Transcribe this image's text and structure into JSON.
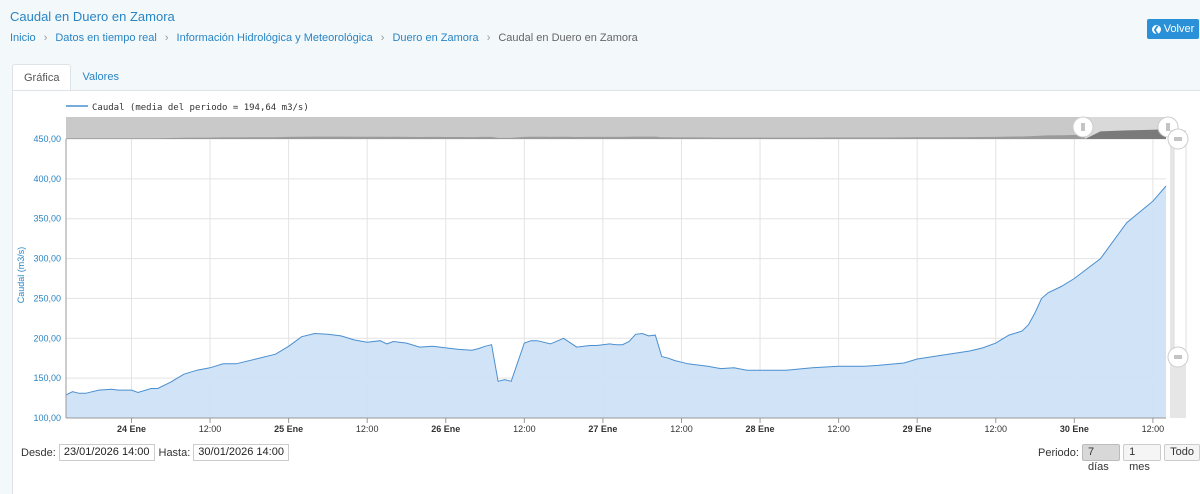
{
  "page": {
    "title": "Caudal en Duero en Zamora",
    "back_label": "Volver",
    "breadcrumb": [
      "Inicio",
      "Datos en tiempo real",
      "Información Hidrológica y Meteorológica",
      "Duero en Zamora",
      "Caudal en Duero en Zamora"
    ]
  },
  "tabs": [
    {
      "label": "Gráfica",
      "active": true
    },
    {
      "label": "Valores",
      "active": false
    }
  ],
  "range": {
    "from_label": "Desde:",
    "from_value": "23/01/2026 14:00",
    "to_label": "Hasta:",
    "to_value": "30/01/2026 14:00",
    "period_label": "Periodo:",
    "period_options": [
      "7 días",
      "1 mes",
      "Todo"
    ],
    "period_selected": "7 días"
  },
  "chart_data": {
    "type": "area",
    "legend": "Caudal (media del periodo = 194,64 m3/s)",
    "legend_placement": "top-left",
    "ylabel": "Caudal (m3/s)",
    "ylim": [
      100,
      450
    ],
    "yticks": [
      "100,00",
      "150,00",
      "200,00",
      "250,00",
      "300,00",
      "350,00",
      "400,00",
      "450,00"
    ],
    "ytick_values": [
      100,
      150,
      200,
      250,
      300,
      350,
      400,
      450
    ],
    "xlim": [
      "23/01/2026 14:00",
      "30/01/2026 14:00"
    ],
    "xticks": [
      "24 Ene",
      "12:00",
      "25 Ene",
      "12:00",
      "26 Ene",
      "12:00",
      "27 Ene",
      "12:00",
      "28 Ene",
      "12:00",
      "29 Ene",
      "12:00",
      "30 Ene",
      "12:00"
    ],
    "xtick_values": [
      "24/01/2026 00:00",
      "24/01/2026 12:00",
      "25/01/2026 00:00",
      "25/01/2026 12:00",
      "26/01/2026 00:00",
      "26/01/2026 12:00",
      "27/01/2026 00:00",
      "27/01/2026 12:00",
      "28/01/2026 00:00",
      "28/01/2026 12:00",
      "29/01/2026 00:00",
      "29/01/2026 12:00",
      "30/01/2026 00:00",
      "30/01/2026 12:00"
    ],
    "xtick_bold": [
      true,
      false,
      true,
      false,
      true,
      false,
      true,
      false,
      true,
      false,
      true,
      false,
      true,
      false
    ],
    "grid": true,
    "colors": {
      "line": "#4a8fd0",
      "fill": "#cfe2f5",
      "grid": "#e3e3e3",
      "axis_text": "#2a85c4",
      "navigator": "#c4c4c4"
    },
    "series": [
      {
        "x": [
          "23/01/2026 14:00",
          "23/01/2026 15:00",
          "23/01/2026 16:00",
          "23/01/2026 17:00",
          "23/01/2026 19:00",
          "23/01/2026 21:00",
          "23/01/2026 22:00",
          "24/01/2026 00:00",
          "24/01/2026 01:00",
          "24/01/2026 03:00",
          "24/01/2026 04:00",
          "24/01/2026 06:00",
          "24/01/2026 08:00",
          "24/01/2026 10:00",
          "24/01/2026 12:00",
          "24/01/2026 14:00",
          "24/01/2026 16:00",
          "24/01/2026 19:00",
          "24/01/2026 22:00",
          "25/01/2026 00:00",
          "25/01/2026 02:00",
          "25/01/2026 04:00",
          "25/01/2026 06:00",
          "25/01/2026 08:00",
          "25/01/2026 10:00",
          "25/01/2026 12:00",
          "25/01/2026 14:00",
          "25/01/2026 15:00",
          "25/01/2026 16:00",
          "25/01/2026 18:00",
          "25/01/2026 20:00",
          "25/01/2026 22:00",
          "26/01/2026 00:00",
          "26/01/2026 02:00",
          "26/01/2026 04:00",
          "26/01/2026 05:00",
          "26/01/2026 06:00",
          "26/01/2026 07:00",
          "26/01/2026 08:00",
          "26/01/2026 09:00",
          "26/01/2026 10:00",
          "26/01/2026 12:00",
          "26/01/2026 13:00",
          "26/01/2026 14:00",
          "26/01/2026 15:00",
          "26/01/2026 16:00",
          "26/01/2026 18:00",
          "26/01/2026 20:00",
          "26/01/2026 22:00",
          "26/01/2026 23:00",
          "27/01/2026 00:00",
          "27/01/2026 01:00",
          "27/01/2026 02:00",
          "27/01/2026 03:00",
          "27/01/2026 04:00",
          "27/01/2026 05:00",
          "27/01/2026 06:00",
          "27/01/2026 07:00",
          "27/01/2026 08:00",
          "27/01/2026 09:00",
          "27/01/2026 10:00",
          "27/01/2026 11:00",
          "27/01/2026 12:00",
          "27/01/2026 13:00",
          "27/01/2026 16:00",
          "27/01/2026 18:00",
          "27/01/2026 20:00",
          "27/01/2026 22:00",
          "28/01/2026 00:00",
          "28/01/2026 04:00",
          "28/01/2026 08:00",
          "28/01/2026 12:00",
          "28/01/2026 16:00",
          "28/01/2026 18:00",
          "28/01/2026 22:00",
          "29/01/2026 00:00",
          "29/01/2026 04:00",
          "29/01/2026 08:00",
          "29/01/2026 10:00",
          "29/01/2026 12:00",
          "29/01/2026 13:00",
          "29/01/2026 14:00",
          "29/01/2026 16:00",
          "29/01/2026 17:00",
          "29/01/2026 18:00",
          "29/01/2026 19:00",
          "29/01/2026 20:00",
          "29/01/2026 22:00",
          "30/01/2026 00:00",
          "30/01/2026 04:00",
          "30/01/2026 08:00",
          "30/01/2026 12:00",
          "30/01/2026 14:00"
        ],
        "y": [
          129,
          133,
          131,
          131,
          135,
          136,
          135,
          135,
          132,
          137,
          137,
          145,
          155,
          160,
          163,
          168,
          168,
          174,
          180,
          190,
          202,
          206,
          205,
          203,
          198,
          195,
          197,
          193,
          196,
          194,
          189,
          190,
          188,
          186,
          185,
          187,
          190,
          192,
          146,
          148,
          146,
          194,
          197,
          197,
          195,
          193,
          200,
          189,
          191,
          191,
          192,
          193,
          192,
          192,
          196,
          205,
          206,
          203,
          204,
          177,
          175,
          172,
          170,
          168,
          165,
          162,
          163,
          160,
          160,
          160,
          163,
          165,
          165,
          166,
          169,
          174,
          179,
          184,
          188,
          194,
          199,
          204,
          209,
          217,
          232,
          250,
          257,
          265,
          275,
          300,
          345,
          372,
          391
        ]
      }
    ]
  }
}
